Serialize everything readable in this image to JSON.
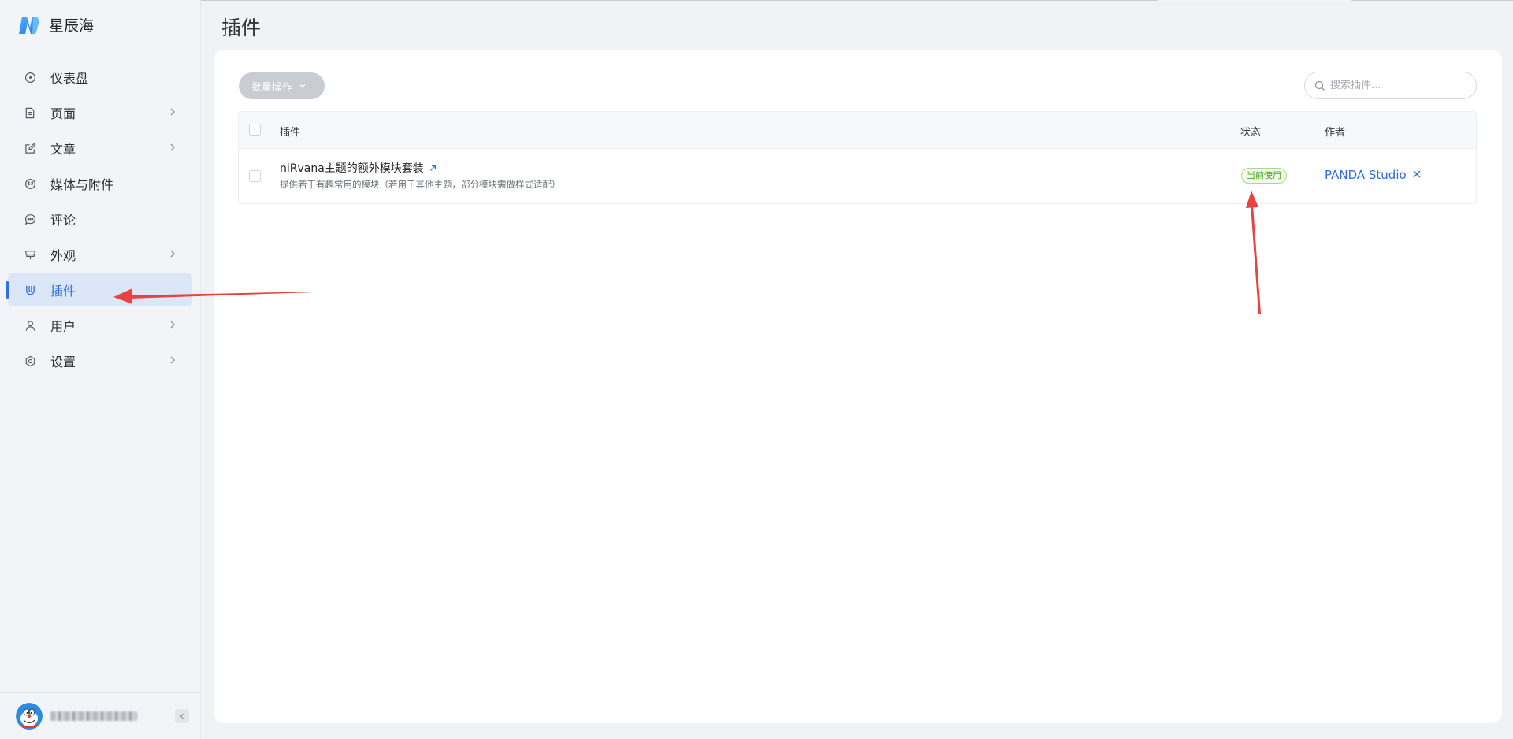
{
  "brand": {
    "name": "星辰海"
  },
  "sidebar": {
    "items": [
      {
        "label": "仪表盘",
        "icon": "dashboard-icon",
        "has_children": false,
        "active": false
      },
      {
        "label": "页面",
        "icon": "page-icon",
        "has_children": true,
        "active": false
      },
      {
        "label": "文章",
        "icon": "edit-icon",
        "has_children": true,
        "active": false
      },
      {
        "label": "媒体与附件",
        "icon": "media-icon",
        "has_children": false,
        "active": false
      },
      {
        "label": "评论",
        "icon": "comment-icon",
        "has_children": false,
        "active": false
      },
      {
        "label": "外观",
        "icon": "appearance-icon",
        "has_children": true,
        "active": false
      },
      {
        "label": "插件",
        "icon": "plugin-icon",
        "has_children": false,
        "active": true
      },
      {
        "label": "用户",
        "icon": "user-icon",
        "has_children": true,
        "active": false
      },
      {
        "label": "设置",
        "icon": "settings-icon",
        "has_children": true,
        "active": false
      }
    ],
    "accent_color": "#2f6fe0"
  },
  "header": {
    "title": "插件"
  },
  "toolbar": {
    "batch_label": "批量操作",
    "search_placeholder": "搜索插件..."
  },
  "table": {
    "columns": {
      "plugin": "插件",
      "status": "状态",
      "author": "作者"
    },
    "rows": [
      {
        "name": "niRvana主题的额外模块套装",
        "description": "提供若干有趣常用的模块（若用于其他主题，部分模块需做样式适配）",
        "status": "当前使用",
        "author": "PANDA Studio"
      }
    ]
  },
  "annotations": {
    "arrow_color": "#e8433f"
  }
}
